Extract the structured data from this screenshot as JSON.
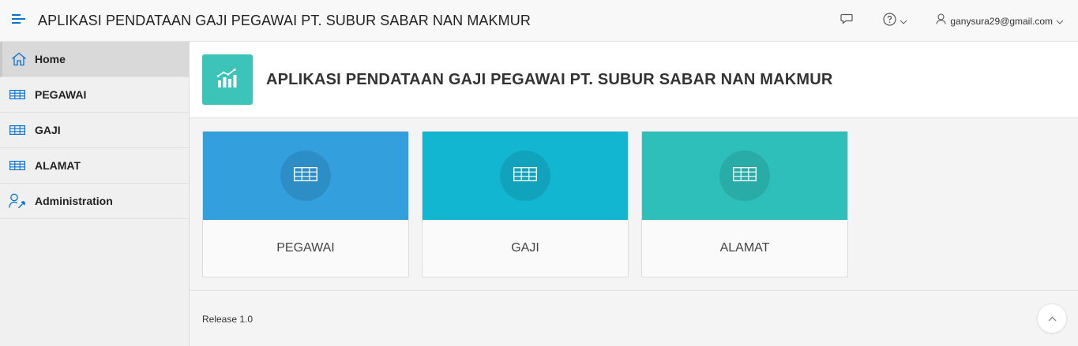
{
  "header": {
    "app_title": "APLIKASI PENDATAAN GAJI PEGAWAI PT. SUBUR SABAR NAN MAKMUR",
    "user_email": "ganysura29@gmail.com",
    "icons": [
      "menu-toggle-icon",
      "chat-icon",
      "help-icon",
      "chevron-down-icon",
      "user-icon"
    ]
  },
  "sidebar": {
    "items": [
      {
        "label": "Home",
        "icon": "home-icon",
        "active": true
      },
      {
        "label": "PEGAWAI",
        "icon": "table-icon"
      },
      {
        "label": "GAJI",
        "icon": "table-icon"
      },
      {
        "label": "ALAMAT",
        "icon": "table-icon"
      },
      {
        "label": "Administration",
        "icon": "user-wrench-icon"
      }
    ]
  },
  "hero": {
    "title": "APLIKASI PENDATAAN GAJI PEGAWAI PT. SUBUR SABAR NAN MAKMUR",
    "icon": "chart-growth-icon"
  },
  "cards": [
    {
      "label": "PEGAWAI",
      "color": "#339fdc",
      "icon": "table-icon"
    },
    {
      "label": "GAJI",
      "color": "#13b6d1",
      "icon": "table-icon"
    },
    {
      "label": "ALAMAT",
      "color": "#2ebfba",
      "icon": "table-icon"
    }
  ],
  "footer": {
    "release": "Release 1.0"
  },
  "colors": {
    "accent": "#0572ce",
    "hero_icon_bg": "#3cc4b8"
  }
}
